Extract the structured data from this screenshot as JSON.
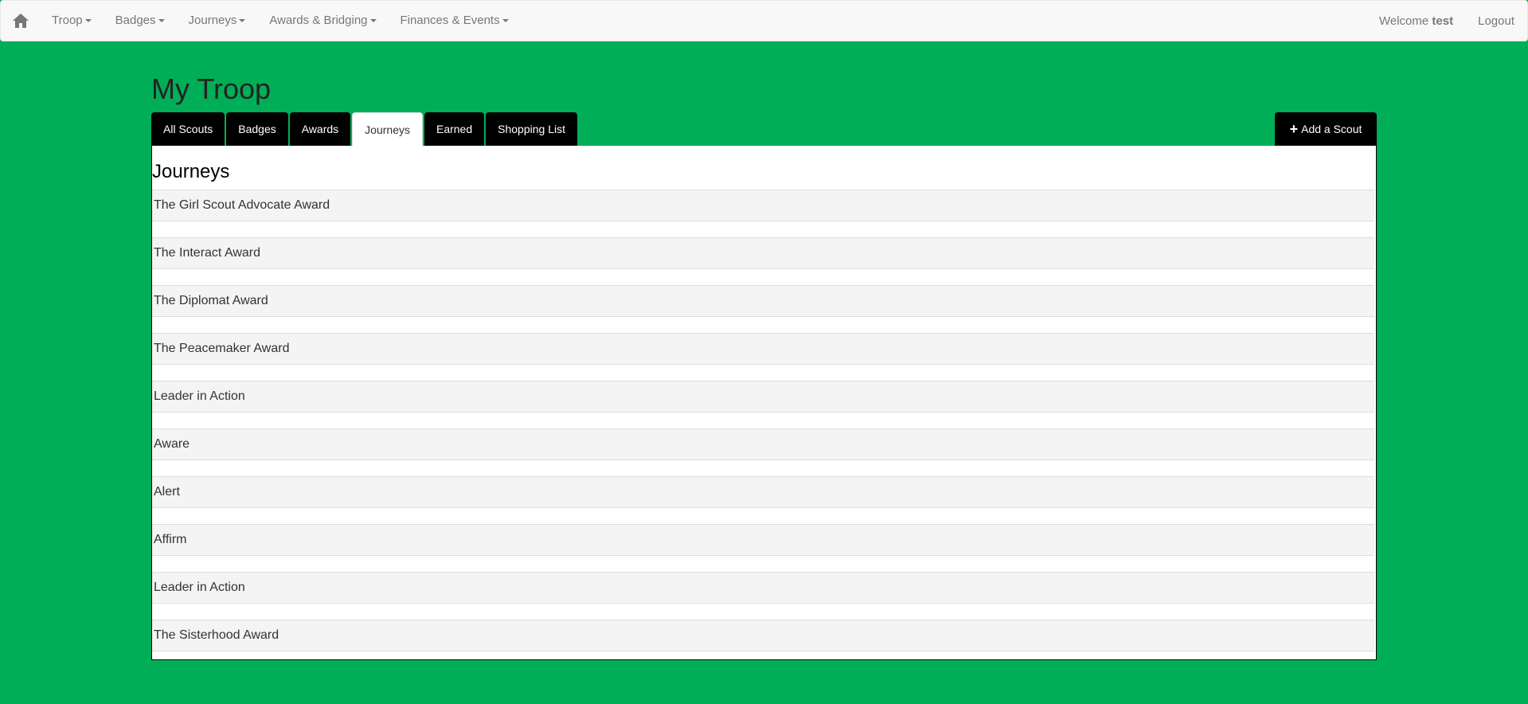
{
  "navbar": {
    "home_icon": "home-icon",
    "items": [
      {
        "label": "Troop"
      },
      {
        "label": "Badges"
      },
      {
        "label": "Journeys"
      },
      {
        "label": "Awards & Bridging"
      },
      {
        "label": "Finances & Events"
      }
    ],
    "welcome_prefix": "Welcome",
    "username": "test",
    "logout_label": "Logout"
  },
  "page": {
    "title": "My Troop",
    "tabs": [
      {
        "label": "All Scouts"
      },
      {
        "label": "Badges"
      },
      {
        "label": "Awards"
      },
      {
        "label": "Journeys"
      },
      {
        "label": "Earned"
      },
      {
        "label": "Shopping List"
      }
    ],
    "active_tab": "Journeys",
    "add_scout_label": "Add a Scout",
    "panel_heading": "Journeys",
    "journeys": [
      "The Girl Scout Advocate Award",
      "The Interact Award",
      "The Diplomat Award",
      "The Peacemaker Award",
      "Leader in Action",
      "Aware",
      "Alert",
      "Affirm",
      "Leader in Action",
      "The Sisterhood Award"
    ]
  },
  "colors": {
    "background": "#00ae57",
    "navbar_bg": "#f8f8f8",
    "tab_bg": "#000000",
    "row_bg": "#f4f4f4"
  }
}
